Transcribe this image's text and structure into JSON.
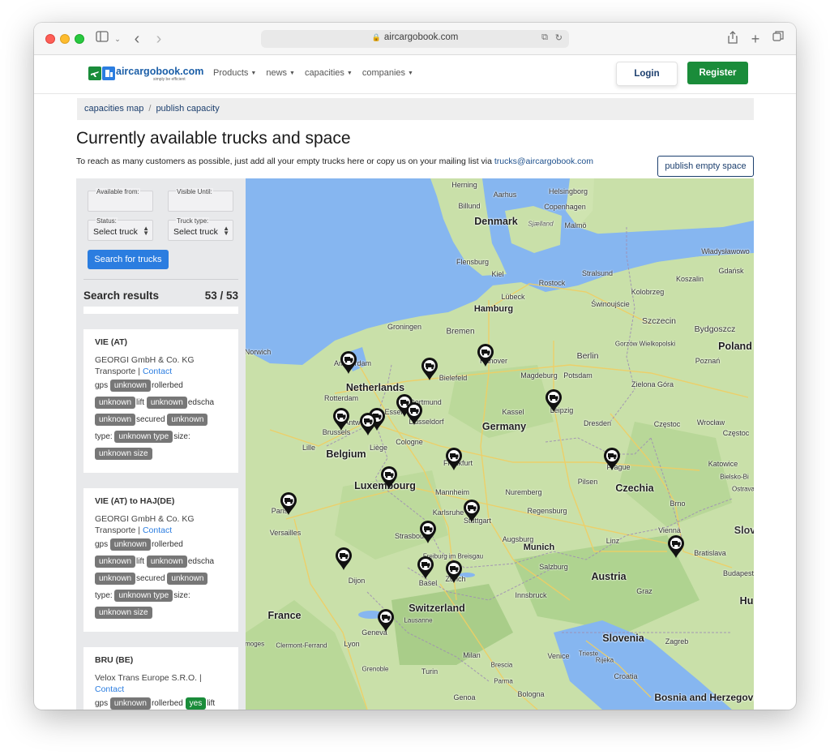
{
  "browser": {
    "url": "aircargobook.com"
  },
  "site": {
    "logo_text": "aircargobook.com",
    "logo_tagline": "simply be efficient",
    "nav": [
      {
        "label": "Products"
      },
      {
        "label": "news"
      },
      {
        "label": "capacities"
      },
      {
        "label": "companies"
      }
    ],
    "login_label": "Login",
    "register_label": "Register"
  },
  "breadcrumb": {
    "items": [
      "capacities map",
      "publish capacity"
    ]
  },
  "page": {
    "title": "Currently available trucks and space",
    "description": "To reach as many customers as possible, just add all your empty trucks here or copy us on your mailing list via ",
    "email": "trucks@aircargobook.com",
    "publish_button": "publish empty space"
  },
  "filters": {
    "available_from_label": "Available from:",
    "available_from_value": "",
    "visible_until_label": "Visible Until:",
    "visible_until_value": "",
    "status_label": "Status:",
    "status_value": "Select truck",
    "truck_type_label": "Truck type:",
    "truck_type_value": "Select truck",
    "search_button": "Search for trucks"
  },
  "results": {
    "label": "Search results",
    "count": "53 / 53",
    "cards": [
      {
        "route": "VIE (AT)",
        "company": "GEORGI GmbH & Co. KG Transporte",
        "sep": " | ",
        "contact": "Contact",
        "gps_label": "gps",
        "gps": "unknown",
        "rollerbed_label": "rollerbed",
        "rollerbed": "unknown",
        "lift_label": "lift",
        "lift": "unknown",
        "edscha_label": "edscha",
        "edscha": "unknown",
        "secured_label": "secured",
        "secured": "unknown",
        "type_label": "type:",
        "type": "unknown type",
        "size_label": "size:",
        "size": "unknown size"
      },
      {
        "route": "VIE (AT) to HAJ(DE)",
        "company": "GEORGI GmbH & Co. KG Transporte",
        "sep": " | ",
        "contact": "Contact",
        "gps_label": "gps",
        "gps": "unknown",
        "rollerbed_label": "rollerbed",
        "rollerbed": "unknown",
        "lift_label": "lift",
        "lift": "unknown",
        "edscha_label": "edscha",
        "edscha": "unknown",
        "secured_label": "secured",
        "secured": "unknown",
        "type_label": "type:",
        "type": "unknown type",
        "size_label": "size:",
        "size": "unknown size"
      },
      {
        "route": "BRU (BE)",
        "company": "Velox Trans Europe S.R.O.",
        "sep": " | ",
        "contact": "Contact",
        "gps_label": "gps",
        "gps": "unknown",
        "rollerbed_label": "rollerbed",
        "rollerbed": "yes",
        "lift_label": "lift"
      }
    ]
  },
  "map": {
    "countries": [
      "Denmark",
      "Netherlands",
      "Belgium",
      "Luxembourg",
      "Germany",
      "Poland",
      "Czechia",
      "Austria",
      "Switzerland",
      "France",
      "Slovenia",
      "Croatia",
      "Bosnia and Herzegovina",
      "Slov",
      "Hu"
    ],
    "cities": [
      "Herning",
      "Aarhus",
      "Helsingborg",
      "Billund",
      "Copenhagen",
      "Malmö",
      "Sjælland",
      "Władysławowo",
      "Gdańsk",
      "Koszalin",
      "Kolobrzeg",
      "Rostock",
      "Stralsund",
      "Flensburg",
      "Kiel",
      "Lübeck",
      "Hamburg",
      "Świnoujście",
      "Szczecin",
      "Bydgoszcz",
      "Groningen",
      "Bremen",
      "Amsterdam",
      "Hanover",
      "Berlin",
      "Bielefeld",
      "Magdeburg",
      "Potsdam",
      "Gorzów Wielkopolski",
      "Poznań",
      "Zielona Góra",
      "Rotterdam",
      "Dortmund",
      "Kassel",
      "Leipzig",
      "Essen",
      "Düsseldorf",
      "Antwerp",
      "Brussels",
      "Cologne",
      "Dresden",
      "Wrocław",
      "Częstoc",
      "Liège",
      "Lille",
      "Frankfurt",
      "Prague",
      "Katowice",
      "Pilsen",
      "Bielsko-Bi",
      "Mannheim",
      "Nuremberg",
      "Ostrava",
      "Brno",
      "Paris",
      "Versailles",
      "Karlsruhe",
      "Stuttgart",
      "Regensburg",
      "Strasbourg",
      "Augsburg",
      "Munich",
      "Linz",
      "Vienna",
      "Bratislava",
      "Freiburg im Breisgau",
      "Salzburg",
      "Dijon",
      "Basel",
      "Zurich",
      "Innsbruck",
      "Budapest",
      "Graz",
      "Lausanne",
      "Geneva",
      "Limoges",
      "Clermont-Ferrand",
      "Lyon",
      "Milan",
      "Venice",
      "Trieste",
      "Zagreb",
      "Rijeka",
      "Brescia",
      "Grenoble",
      "Turin",
      "Parma",
      "Genoa",
      "Bologna",
      "Norwich"
    ],
    "marker_count": 20
  }
}
